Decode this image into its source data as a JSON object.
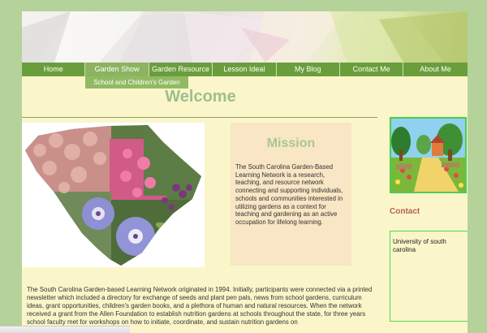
{
  "nav": {
    "items": [
      {
        "label": "Home",
        "active": false
      },
      {
        "label": "Garden Show",
        "active": true
      },
      {
        "label": "Garden Resource",
        "active": false
      },
      {
        "label": "Lesson Ideal",
        "active": false
      },
      {
        "label": "My Blog",
        "active": false
      },
      {
        "label": "Contact Me",
        "active": false
      },
      {
        "label": "About Me",
        "active": false
      }
    ],
    "submenu": {
      "label": "School and Children's Garden"
    }
  },
  "main": {
    "title": "Welcome",
    "intro": "The South Carolina Garden-based Learning Network originated in 1994. Initially, participants were connected via a printed newsletter which included a directory for exchange of seeds and plant pen pals, news from school gardens, curriculum ideas, grant opportunities, children's garden books, and a plethora of human and natural resources. When the network received a grant from the Allen Foundation to establish nutrition gardens at schools throughout the state, for three years school faculty met for workshops on how to initiate, coordinate, and sustain nutrition gardens on"
  },
  "mission": {
    "title": "Mission",
    "text": "The South Carolina Garden-Based Learning Network is a research, teaching, and resource network connecting and supporting individuals, schools and communities interested in utilizing gardens as a context for teaching and gardening as an active occupation for lifelong learning."
  },
  "sidebar": {
    "contact_heading": "Contact",
    "contact_text": "University of south carolina"
  },
  "colors": {
    "page_background": "#b5d29a",
    "content_background": "#fbf6c9",
    "nav_green": "#6a9e3c",
    "heading_green": "#9fbe8d",
    "contact_red": "#b75f58"
  }
}
